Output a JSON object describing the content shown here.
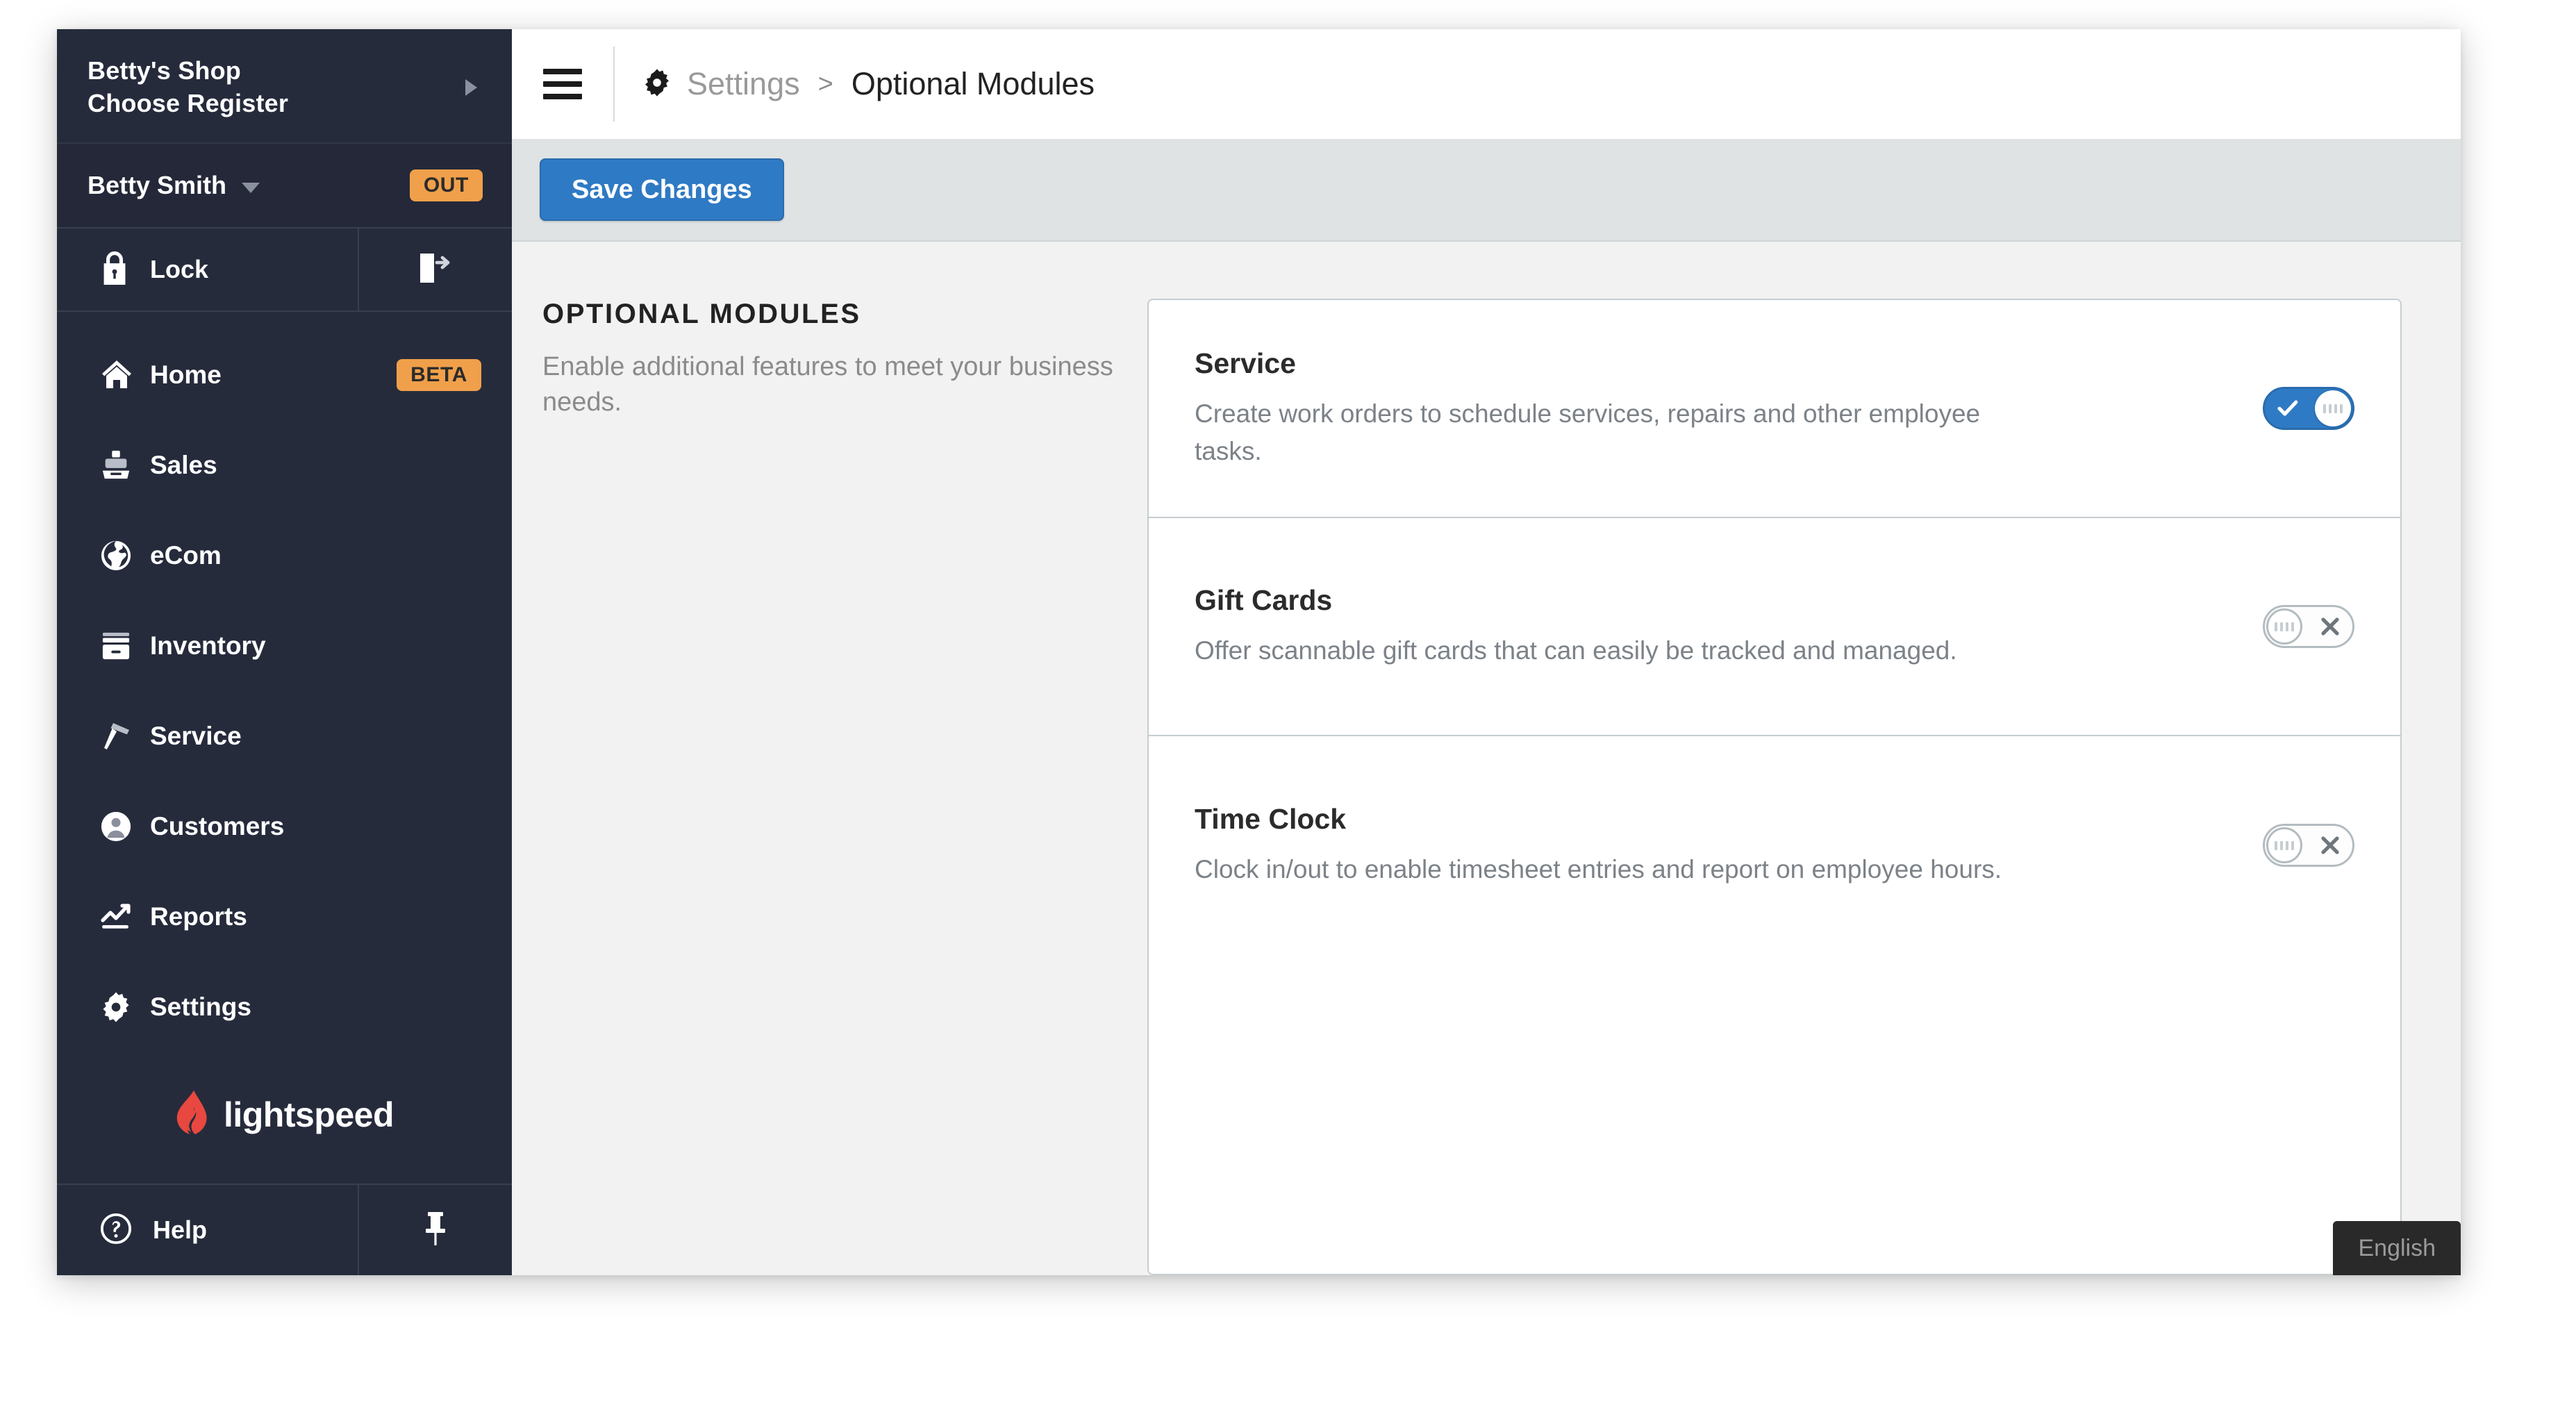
{
  "sidebar": {
    "shop": {
      "name": "Betty's Shop",
      "register": "Choose Register",
      "expand_icon": "caret-right-icon"
    },
    "user": {
      "name": "Betty Smith",
      "status_badge": "OUT",
      "dropdown_icon": "caret-down-icon"
    },
    "lock": {
      "label": "Lock",
      "icon": "lock-icon",
      "logout_icon": "logout-icon"
    },
    "nav_items": [
      {
        "label": "Home",
        "icon": "home-icon",
        "badge": "BETA"
      },
      {
        "label": "Sales",
        "icon": "cash-register-icon",
        "badge": ""
      },
      {
        "label": "eCom",
        "icon": "globe-icon",
        "badge": ""
      },
      {
        "label": "Inventory",
        "icon": "drawer-icon",
        "badge": ""
      },
      {
        "label": "Service",
        "icon": "hammer-icon",
        "badge": ""
      },
      {
        "label": "Customers",
        "icon": "person-circle-icon",
        "badge": ""
      },
      {
        "label": "Reports",
        "icon": "chart-line-icon",
        "badge": ""
      },
      {
        "label": "Settings",
        "icon": "gear-icon",
        "badge": ""
      }
    ],
    "logo": {
      "text": "lightspeed",
      "icon": "lightspeed-flame-icon",
      "color": "#e8483f"
    },
    "help": {
      "label": "Help",
      "icon": "question-circle-icon",
      "pin_icon": "pin-icon"
    }
  },
  "topbar": {
    "menu_icon": "hamburger-icon",
    "breadcrumb": {
      "icon": "gear-icon",
      "parent": "Settings",
      "separator": ">",
      "current": "Optional Modules"
    }
  },
  "toolbar": {
    "save_label": "Save Changes",
    "save_color": "#2f7ac4"
  },
  "content": {
    "section_title": "OPTIONAL MODULES",
    "section_desc": "Enable additional features to meet your business needs.",
    "modules": [
      {
        "title": "Service",
        "description": "Create work orders to schedule services, repairs and other employee tasks.",
        "enabled": true,
        "toggle_icon": "check-icon"
      },
      {
        "title": "Gift Cards",
        "description": "Offer scannable gift cards that can easily be tracked and managed.",
        "enabled": false,
        "toggle_icon": "x-icon"
      },
      {
        "title": "Time Clock",
        "description": "Clock in/out to enable timesheet entries and report on employee hours.",
        "enabled": false,
        "toggle_icon": "x-icon"
      }
    ]
  },
  "footer": {
    "language_badge": "English"
  }
}
